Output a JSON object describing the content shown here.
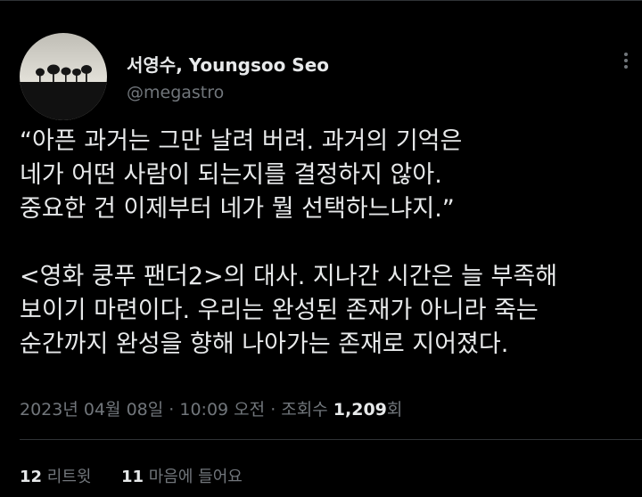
{
  "author": {
    "display_name": "서영수, Youngsoo Seo",
    "handle": "@megastro",
    "avatar_description": "avatar-landscape-trees"
  },
  "tweet": {
    "lines": [
      "“아픈 과거는 그만 날려 버려. 과거의 기억은",
      "네가 어떤 사람이 되는지를 결정하지 않아.",
      "중요한 건 이제부터 네가 뭘 선택하느냐지.”",
      "",
      "<영화 쿵푸 팬더2>의 대사. 지나간 시간은 늘 부족해",
      "보이기 마련이다. 우리는 완성된 존재가 아니라 죽는",
      "순간까지 완성을 향해 나아가는 존재로 지어졌다."
    ]
  },
  "meta": {
    "date": "2023년 04월 08일",
    "separator": "·",
    "time": "10:09 오전",
    "views_label": "조회수",
    "views_count": "1,209",
    "views_suffix": "회"
  },
  "stats": {
    "retweets_count": "12",
    "retweets_label": "리트윗",
    "likes_count": "11",
    "likes_label": "마음에 들어요"
  },
  "colors": {
    "background": "#000000",
    "primary_text": "#e7e9ea",
    "secondary_text": "#71767b",
    "divider": "#2f3336"
  }
}
